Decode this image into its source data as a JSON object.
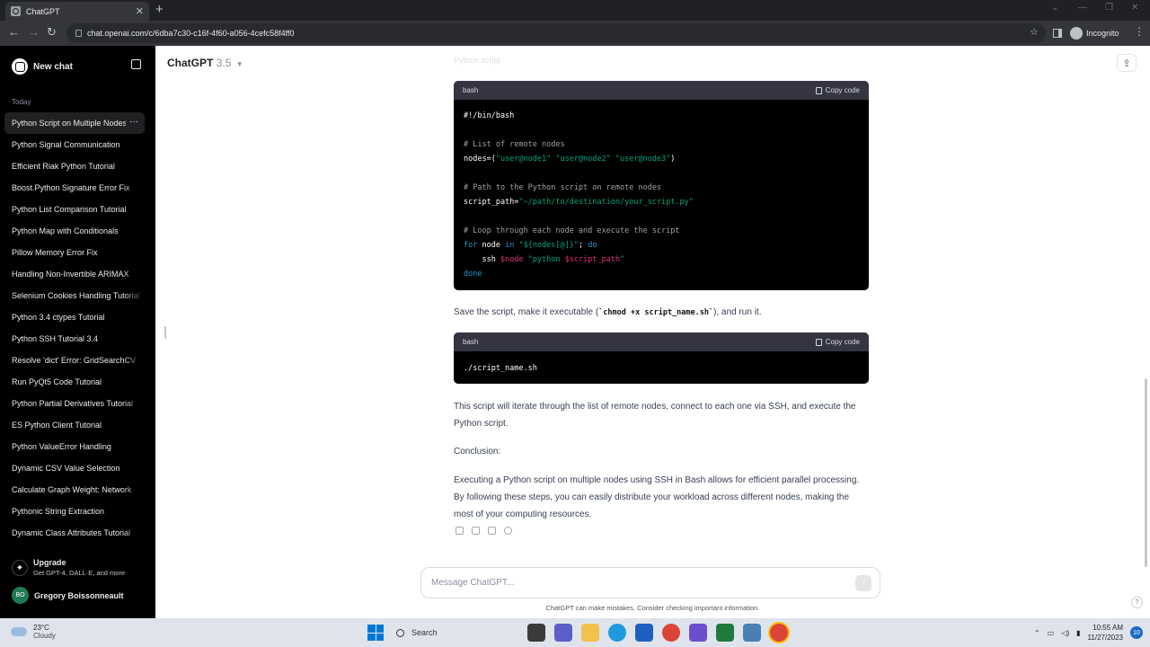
{
  "browser": {
    "tab_title": "ChatGPT",
    "url": "chat.openai.com/c/6dba7c30-c16f-4f60-a056-4cefc58f4ff0",
    "incognito_label": "Incognito",
    "new_tab_glyph": "+",
    "close_glyph": "✕"
  },
  "sidebar": {
    "new_chat": "New chat",
    "section_today": "Today",
    "conversations": [
      "Python Script on Multiple Nodes",
      "Python Signal Communication",
      "Efficient Riak Python Tutorial",
      "Boost.Python Signature Error Fix",
      "Python List Comparison Tutorial",
      "Python Map with Conditionals",
      "Pillow Memory Error Fix",
      "Handling Non-Invertible ARIMAX",
      "Selenium Cookies Handling Tutorial",
      "Python 3.4 ctypes Tutorial",
      "Python SSH Tutorial 3.4",
      "Resolve 'dict' Error: GridSearchCV",
      "Run PyQt5 Code Tutorial",
      "Python Partial Derivatives Tutorial",
      "ES Python Client Tutorial",
      "Python ValueError Handling",
      "Dynamic CSV Value Selection",
      "Calculate Graph Weight: Network",
      "Pythonic String Extraction",
      "Dynamic Class Attributes Tutorial"
    ],
    "upgrade_title": "Upgrade",
    "upgrade_sub": "Get GPT-4, DALL·E, and more",
    "user_initials": "BO",
    "user_name": "Gregory Boissonneault"
  },
  "header": {
    "model_name": "ChatGPT",
    "model_version": "3.5"
  },
  "content": {
    "partial_text": "Python script",
    "code1_lang": "bash",
    "copy_label": "Copy code",
    "save_prefix": "Save the script, make it executable (",
    "save_code": "`chmod +x script_name.sh`",
    "save_suffix": "), and run it.",
    "code2_lang": "bash",
    "code2": "./script_name.sh",
    "para1": "This script will iterate through the list of remote nodes, connect to each one via SSH, and execute the Python script.",
    "conclusion_label": "Conclusion:",
    "para2": "Executing a Python script on multiple nodes using SSH in Bash allows for efficient parallel processing. By following these steps, you can easily distribute your workload across different nodes, making the most of your computing resources."
  },
  "code1": {
    "shebang": "#!/bin/bash",
    "c1": "# List of remote nodes",
    "nodes_lhs": "nodes=(",
    "nodes_str": "\"user@node1\" \"user@node2\" \"user@node3\"",
    "nodes_rhs": ")",
    "c2": "# Path to the Python script on remote nodes",
    "path_lhs": "script_path=",
    "path_str": "\"~/path/to/destination/your_script.py\"",
    "c3": "# Loop through each node and execute the script",
    "for_kw": "for",
    "for_var": " node ",
    "in_kw": "in",
    "for_str": " \"${nodes[@]}\"",
    "semi": "; ",
    "do_kw": "do",
    "ssh_cmd": "    ssh ",
    "ssh_var": "$node",
    "ssh_str1": " \"python ",
    "ssh_var2": "$script_path",
    "ssh_str2": "\"",
    "done_kw": "done"
  },
  "composer": {
    "placeholder": "Message ChatGPT...",
    "disclaimer": "ChatGPT can make mistakes. Consider checking important information.",
    "help": "?"
  },
  "taskbar": {
    "temp": "23°C",
    "weather": "Cloudy",
    "search": "Search",
    "time": "10:55 AM",
    "date": "11/27/2023",
    "notifications": "10"
  }
}
